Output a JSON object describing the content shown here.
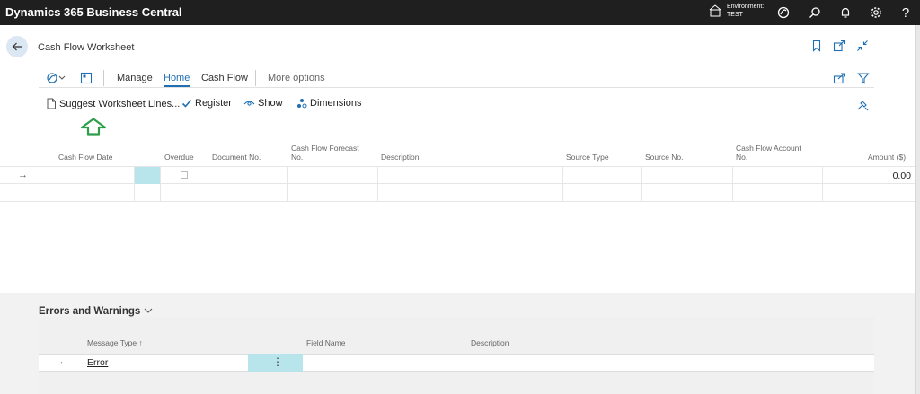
{
  "app": {
    "title": "Dynamics 365 Business Central"
  },
  "environment": {
    "label": "Environment:",
    "value": "TEST"
  },
  "top_icons": [
    "copilot-icon",
    "search-icon",
    "bell-icon",
    "gear-icon",
    "help-icon"
  ],
  "help_glyph": "?",
  "page": {
    "title": "Cash Flow Worksheet"
  },
  "actionbar": {
    "manage": "Manage",
    "home": "Home",
    "cash_flow": "Cash Flow",
    "more": "More options"
  },
  "commands": {
    "suggest": "Suggest Worksheet Lines...",
    "register": "Register",
    "show": "Show",
    "dimensions": "Dimensions"
  },
  "grid": {
    "headers": {
      "date": "Cash Flow Date",
      "overdue": "Overdue",
      "doc_no": "Document No.",
      "forecast_no_1": "Cash Flow Forecast",
      "forecast_no_2": "No.",
      "description": "Description",
      "source_type": "Source Type",
      "source_no": "Source No.",
      "account_no_1": "Cash Flow Account",
      "account_no_2": "No.",
      "amount": "Amount ($)"
    },
    "row1": {
      "amount": "0.00",
      "arrow": "→"
    }
  },
  "errors": {
    "title": "Errors and Warnings",
    "headers": {
      "message_type": "Message Type ↑",
      "field_name": "Field Name",
      "description": "Description"
    },
    "row": {
      "arrow": "→",
      "message_type": "Error",
      "menu": "⋮"
    }
  },
  "colors": {
    "topbar": "#1f1f1f",
    "accent": "#1f6fb2",
    "selected_cell": "#b8e4ec",
    "hint_arrow": "#2e9e4a"
  }
}
